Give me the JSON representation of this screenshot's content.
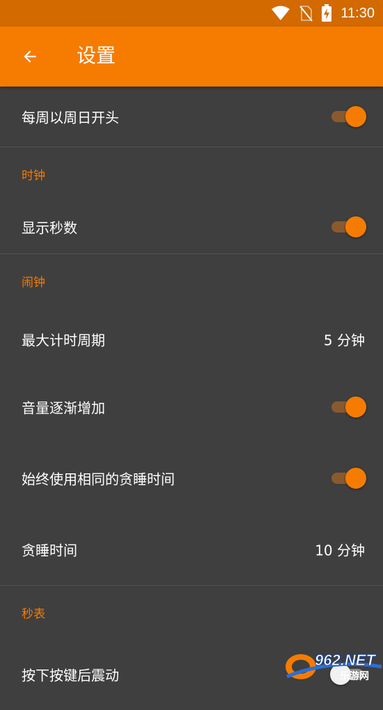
{
  "status_bar": {
    "time": "11:30",
    "icons": [
      "wifi-icon",
      "no-sim-icon",
      "battery-charging-icon"
    ]
  },
  "app_bar": {
    "back_icon": "arrow-back-icon",
    "title": "设置"
  },
  "settings": {
    "week_start": {
      "label": "每周以周日开头",
      "toggle_on": true
    },
    "clock_section": {
      "title": "时钟"
    },
    "show_seconds": {
      "label": "显示秒数",
      "toggle_on": true
    },
    "alarm_section": {
      "title": "闹钟"
    },
    "max_duration": {
      "label": "最大计时周期",
      "value": "5 分钟"
    },
    "volume_increase": {
      "label": "音量逐渐增加",
      "toggle_on": true
    },
    "same_snooze": {
      "label": "始终使用相同的贪睡时间",
      "toggle_on": true
    },
    "snooze_time": {
      "label": "贪睡时间",
      "value": "10 分钟"
    },
    "stopwatch_section": {
      "title": "秒表"
    },
    "vibrate_on_press": {
      "label": "按下按键后震动",
      "toggle_on": false
    }
  },
  "watermark": {
    "brand": "962.NET",
    "subtitle": "乐游网"
  },
  "colors": {
    "accent": "#f57c00",
    "status_bar": "#d26a00",
    "background": "#3f3f3f"
  }
}
